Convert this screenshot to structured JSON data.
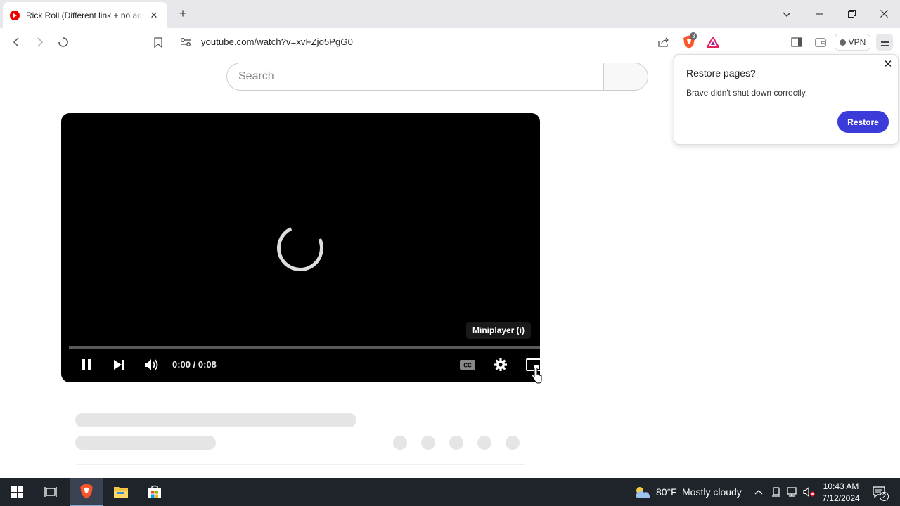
{
  "browser": {
    "tab_title": "Rick Roll (Different link + no ads)",
    "url": "youtube.com/watch?v=xvFZjo5PgG0",
    "vpn_label": "VPN",
    "shields_count": "3"
  },
  "youtube": {
    "search_placeholder": "Search"
  },
  "player": {
    "timecode": "0:00 / 0:08",
    "tooltip": "Miniplayer (i)",
    "progress": 0
  },
  "popup": {
    "title": "Restore pages?",
    "message": "Brave didn't shut down correctly.",
    "button": "Restore"
  },
  "taskbar": {
    "weather_temp": "80°F",
    "weather_desc": "Mostly cloudy",
    "time": "10:43 AM",
    "date": "7/12/2024",
    "notification_count": "2"
  },
  "colors": {
    "brave_orange": "#fb542b",
    "restore_button": "#3b3bd9",
    "taskbar": "#1f242b"
  }
}
